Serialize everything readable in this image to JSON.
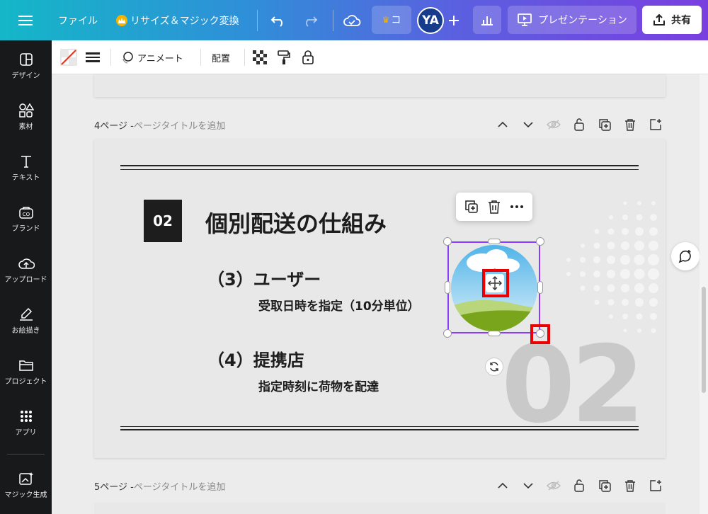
{
  "topbar": {
    "file": "ファイル",
    "resize": "リサイズ＆マジック変換",
    "premium_tag": "コ",
    "avatar": "YA",
    "present": "プレゼンテーション",
    "share": "共有"
  },
  "toolbar": {
    "animate": "アニメート",
    "position": "配置"
  },
  "sidebar": {
    "items": [
      {
        "label": "デザイン",
        "icon": "design-icon"
      },
      {
        "label": "素材",
        "icon": "elements-icon"
      },
      {
        "label": "テキスト",
        "icon": "text-icon"
      },
      {
        "label": "ブランド",
        "icon": "brand-icon"
      },
      {
        "label": "アップロード",
        "icon": "upload-icon"
      },
      {
        "label": "お絵描き",
        "icon": "draw-icon"
      },
      {
        "label": "プロジェクト",
        "icon": "folder-icon"
      },
      {
        "label": "アプリ",
        "icon": "apps-icon"
      },
      {
        "label": "マジック生成",
        "icon": "magic-icon"
      }
    ]
  },
  "pages": {
    "page4_label": "4ページ - ",
    "page4_title_placeholder": "ページタイトルを追加",
    "page5_label": "5ページ - ",
    "page5_title_placeholder": "ページタイトルを追加"
  },
  "slide": {
    "number": "02",
    "title": "個別配送の仕組み",
    "item3_heading": "（3）ユーザー",
    "item3_desc": "受取日時を指定（10分単位）",
    "item4_heading": "（4）提携店",
    "item4_desc": "指定時刻に荷物を配達",
    "big_number": "02"
  },
  "colors": {
    "selection": "#8b3dff",
    "highlight": "#e00000",
    "sidebar_bg": "#18191b"
  }
}
